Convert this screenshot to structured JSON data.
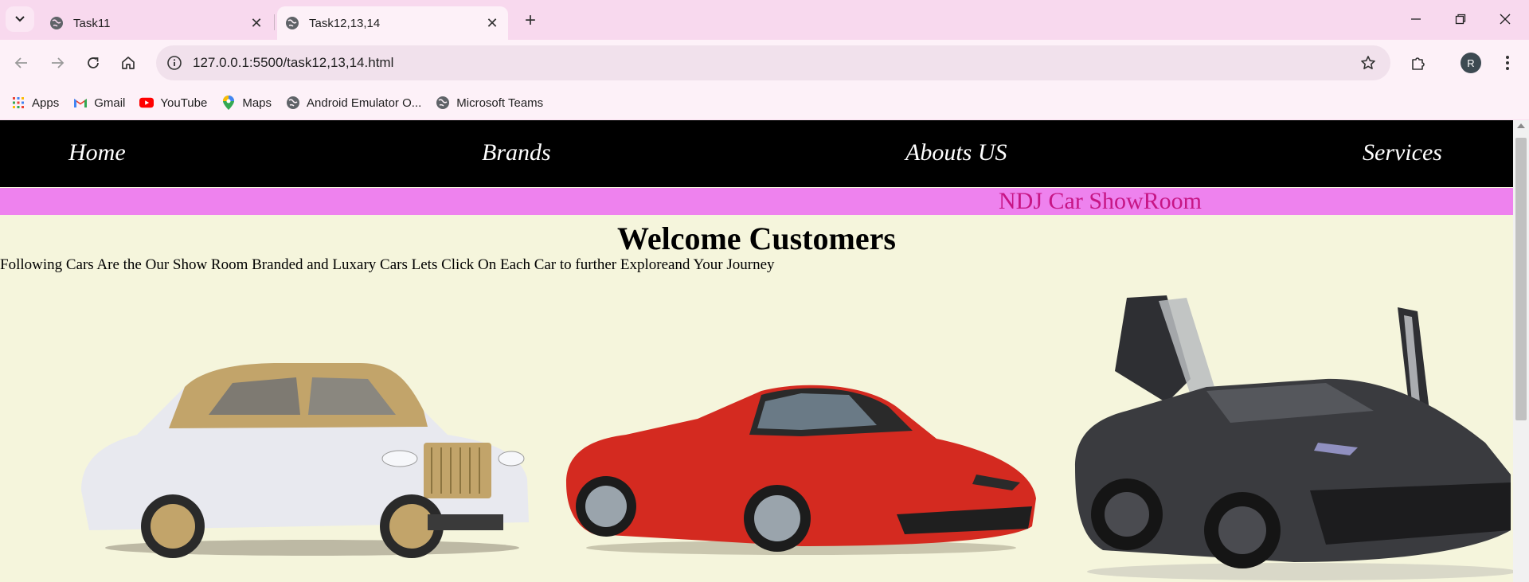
{
  "browser": {
    "tabs": [
      {
        "title": "Task11",
        "active": false
      },
      {
        "title": "Task12,13,14",
        "active": true
      }
    ],
    "url": "127.0.0.1:5500/task12,13,14.html",
    "profile_initial": "R",
    "bookmarks": [
      {
        "label": "Apps",
        "icon": "apps-grid-icon"
      },
      {
        "label": "Gmail",
        "icon": "gmail-icon"
      },
      {
        "label": "YouTube",
        "icon": "youtube-icon"
      },
      {
        "label": "Maps",
        "icon": "maps-pin-icon"
      },
      {
        "label": "Android Emulator O...",
        "icon": "globe-icon"
      },
      {
        "label": "Microsoft Teams",
        "icon": "globe-icon"
      }
    ]
  },
  "page": {
    "nav": [
      "Home",
      "Brands",
      "Abouts US",
      "Services"
    ],
    "marquee": "NDJ Car ShowRoom",
    "heading": "Welcome Customers",
    "intro": "Following Cars Are the Our Show Room Branded and Luxary Cars Lets Click On Each Car to further Exploreand Your Journey",
    "cars": [
      {
        "name": "rolls-royce-wraith",
        "body_color": "#e8e9ef",
        "accent_color": "#c2a46a"
      },
      {
        "name": "ferrari-488",
        "body_color": "#d42a20",
        "accent_color": "#2a2a2a"
      },
      {
        "name": "lamborghini-aventador",
        "body_color": "#3a3b3f",
        "accent_color": "#1c1c1e"
      }
    ]
  },
  "colors": {
    "tabstrip": "#f8d9ee",
    "page_bg": "#f5f5dc",
    "nav_bg": "#000000",
    "marquee_bg": "#ee82ee",
    "marquee_text": "#c71585"
  }
}
